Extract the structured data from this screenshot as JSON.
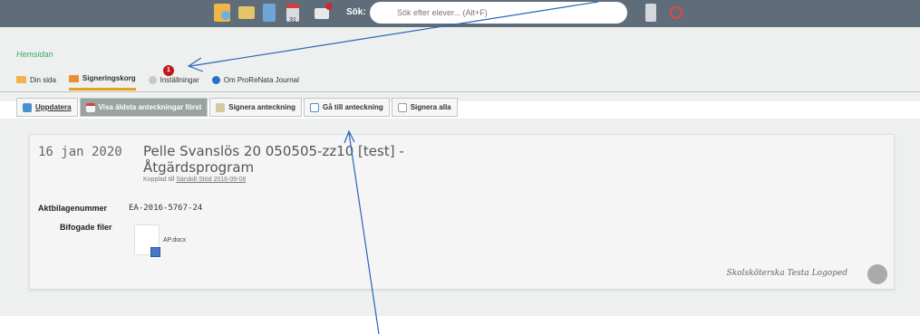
{
  "topbar": {
    "search_label": "Sök:",
    "search_placeholder": "Sök efter elever... (Alt+F)",
    "calendar_day": "31"
  },
  "breadcrumb": "Hemsidan",
  "nav": {
    "tabs": [
      {
        "label": "Din sida",
        "icon": "book-icon"
      },
      {
        "label": "Signeringskorg",
        "icon": "inbox-icon"
      },
      {
        "label": "Inställningar",
        "icon": "gear-icon"
      },
      {
        "label": "Om ProReNata Journal",
        "icon": "info-icon"
      }
    ],
    "badge_count": "1"
  },
  "toolbar": {
    "buttons": [
      {
        "label": "Uppdatera",
        "icon": "refresh-icon"
      },
      {
        "label": "Visa äldsta anteckningar först",
        "icon": "calendar-icon"
      },
      {
        "label": "Signera anteckning",
        "icon": "pen-icon"
      },
      {
        "label": "Gå till anteckning",
        "icon": "document-icon"
      },
      {
        "label": "Signera alla",
        "icon": "document-icon"
      }
    ]
  },
  "card": {
    "date": "16 jan 2020",
    "title": "Pelle Svanslös 20 050505-zz10 [test] - Åtgärdsprogram",
    "link_prefix": "Kopplad till",
    "link_text": "Särskilt Stöd 2016-09-08",
    "aktbilaga_label": "Aktbilagenummer",
    "aktbilaga_value": "EA-2016-5767-24",
    "files_label": "Bifogade filer",
    "file_name": "AP.docx",
    "signer": "Skolsköterska Testa Logoped"
  },
  "colors": {
    "topbar": "#5f6d7a",
    "accent_green": "#3fa56b",
    "tab_underline": "#e8a020",
    "badge": "#c01818",
    "arrow": "#2a64b8"
  }
}
